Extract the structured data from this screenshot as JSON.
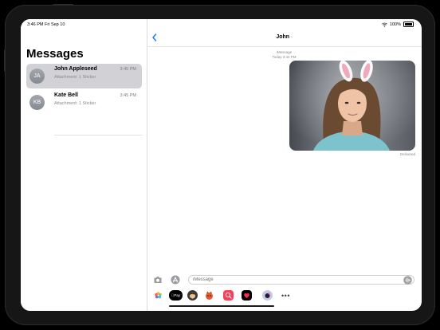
{
  "status_bar": {
    "time_date": "3:46 PM  Fri Sep 10",
    "battery": "100%",
    "icons": [
      "wifi-icon",
      "battery-icon"
    ]
  },
  "sidebar": {
    "title": "Messages",
    "conversations": [
      {
        "initials": "JA",
        "name": "John Appleseed",
        "time": "3:45 PM",
        "preview": "Attachment: 1 Sticker",
        "selected": true
      },
      {
        "initials": "KB",
        "name": "Kate Bell",
        "time": "3:45 PM",
        "preview": "Attachment: 1 Sticker",
        "selected": false
      }
    ]
  },
  "chat": {
    "contact_name": "John",
    "service_label": "iMessage",
    "timestamp": "Today 3:44 PM",
    "delivered_label": "Delivered",
    "attachment": "photo with bunny ears sticker"
  },
  "composer": {
    "placeholder": "iMessage",
    "icons": [
      "camera-icon",
      "app-store-icon",
      "audio-waveform-icon"
    ]
  },
  "app_drawer": {
    "apps": [
      {
        "name": "photos-app-icon"
      },
      {
        "name": "apple-pay-app-icon",
        "label": "Pay"
      },
      {
        "name": "memoji-app-icon"
      },
      {
        "name": "animoji-app-icon"
      },
      {
        "name": "images-search-app-icon"
      },
      {
        "name": "digital-touch-app-icon"
      },
      {
        "name": "music-app-icon"
      },
      {
        "name": "more-apps-icon"
      }
    ]
  },
  "colors": {
    "accent": "#0a7aff",
    "selected_row": "#d1d1d6",
    "avatar": "#8e9299"
  }
}
